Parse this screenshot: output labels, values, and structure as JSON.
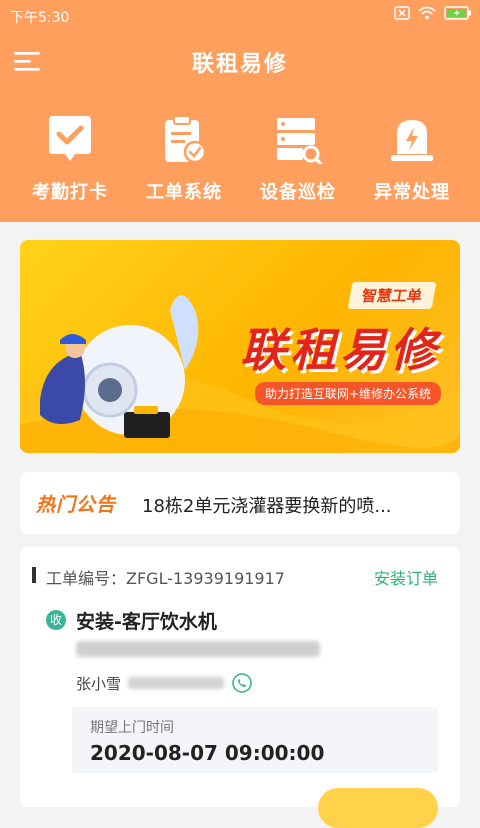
{
  "status_bar": {
    "time": "下午5:30"
  },
  "header": {
    "title": "联租易修",
    "quick_actions": [
      {
        "label": "考勤打卡",
        "icon": "checkin-icon"
      },
      {
        "label": "工单系统",
        "icon": "clipboard-check-icon"
      },
      {
        "label": "设备巡检",
        "icon": "server-search-icon"
      },
      {
        "label": "异常处理",
        "icon": "alarm-light-icon"
      }
    ]
  },
  "banner": {
    "tag": "智慧工单",
    "title": "联租易修",
    "subtitle": "助力打造互联网+维修办公系统"
  },
  "notice": {
    "tag": "热门公告",
    "text": "18栋2单元浇灌器要换新的喷..."
  },
  "order": {
    "number_label": "工单编号：",
    "number": "ZFGL-13939191917",
    "type": "安装订单",
    "badge": "收",
    "title": "安装-客厅饮水机",
    "customer_name": "张小雪",
    "expected_label": "期望上门时间",
    "expected_time": "2020-08-07 09:00:00"
  },
  "colors": {
    "header": "#ff9f5e",
    "accent_green": "#2fb37a",
    "notice_orange": "#f07318"
  }
}
